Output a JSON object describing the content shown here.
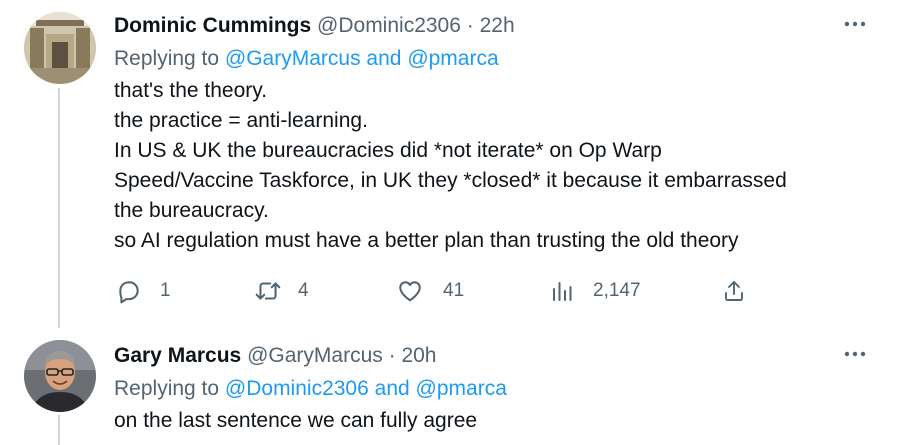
{
  "tweets": [
    {
      "name": "Dominic Cummings",
      "handle": "@Dominic2306",
      "separator": "·",
      "time": "22h",
      "replying_prefix": "Replying to",
      "reply_to_1": "@GaryMarcus",
      "reply_and": "and",
      "reply_to_2": "@pmarca",
      "lines": [
        "that's the theory.",
        "the practice = anti-learning.",
        "In US & UK the bureaucracies did *not iterate* on  Op Warp",
        "Speed/Vaccine Taskforce, in UK they *closed* it because it embarrassed",
        "the bureaucracy.",
        "so AI regulation must have a better plan than trusting the old theory"
      ],
      "replies": "1",
      "retweets": "4",
      "likes": "41",
      "views": "2,147"
    },
    {
      "name": "Gary Marcus",
      "handle": "@GaryMarcus",
      "separator": "·",
      "time": "20h",
      "replying_prefix": "Replying to",
      "reply_to_1": "@Dominic2306",
      "reply_and": "and",
      "reply_to_2": "@pmarca",
      "lines": [
        "on the last sentence we can fully agree"
      ]
    }
  ],
  "colors": {
    "text": "#0f1419",
    "secondary": "#536471",
    "link": "#1d9bf0",
    "thread_line": "#cfd9de"
  },
  "icons": [
    "more-icon",
    "reply-icon",
    "retweet-icon",
    "like-icon",
    "views-icon",
    "share-icon"
  ]
}
